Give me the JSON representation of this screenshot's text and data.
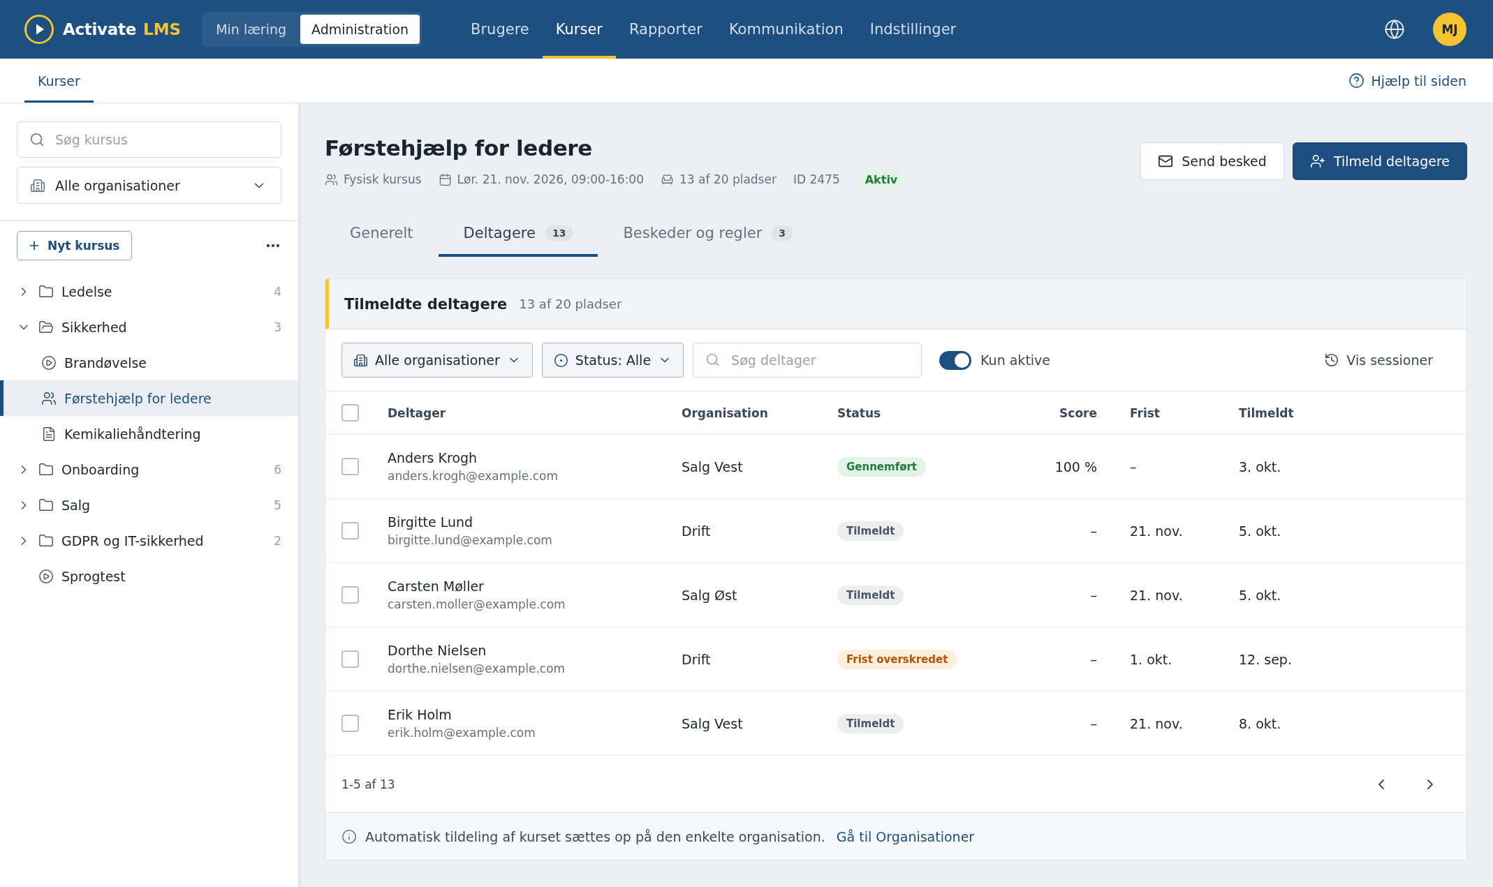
{
  "header": {
    "logo": {
      "name": "Activate",
      "suffix": "LMS"
    },
    "mode_switch": [
      {
        "label": "Min læring",
        "selected": false
      },
      {
        "label": "Administration",
        "selected": true
      }
    ],
    "nav": [
      {
        "label": "Brugere",
        "selected": false
      },
      {
        "label": "Kurser",
        "selected": true
      },
      {
        "label": "Rapporter",
        "selected": false
      },
      {
        "label": "Kommunikation",
        "selected": false
      },
      {
        "label": "Indstillinger",
        "selected": false
      }
    ],
    "avatar": {
      "initials": "MJ"
    }
  },
  "subnav": {
    "tabs": [
      {
        "label": "Kurser",
        "selected": true
      }
    ],
    "help_link": "Hjælp til siden"
  },
  "sidebar": {
    "search": {
      "placeholder": "Søg kursus"
    },
    "organisation_select": {
      "value": "Alle organisationer"
    },
    "new_button": "Nyt kursus",
    "tree": [
      {
        "kind": "folder",
        "label": "Ledelse",
        "count": "4",
        "expanded": false,
        "selected": false
      },
      {
        "kind": "folder",
        "label": "Sikkerhed",
        "count": "3",
        "expanded": true,
        "selected": false,
        "children": [
          {
            "kind": "elearning",
            "label": "Brandøvelse",
            "selected": false
          },
          {
            "kind": "classroom",
            "label": "Førstehjælp for ledere",
            "selected": true
          },
          {
            "kind": "document",
            "label": "Kemikaliehåndtering",
            "selected": false
          }
        ]
      },
      {
        "kind": "folder",
        "label": "Onboarding",
        "count": "6",
        "expanded": false,
        "selected": false
      },
      {
        "kind": "folder",
        "label": "Salg",
        "count": "5",
        "expanded": false,
        "selected": false
      },
      {
        "kind": "folder",
        "label": "GDPR og IT-sikkerhed",
        "count": "2",
        "expanded": false,
        "selected": false
      },
      {
        "kind": "elearning",
        "label": "Sprogtest",
        "selected": false
      }
    ]
  },
  "course": {
    "title": "Førstehjælp for ledere",
    "meta": [
      {
        "kind": "format",
        "text": "Fysisk kursus"
      },
      {
        "kind": "date",
        "text": "Lør. 21. nov. 2026, 09:00-16:00"
      },
      {
        "kind": "seats",
        "text": "13 af 20 pladser"
      },
      {
        "kind": "id",
        "text": "ID 2475"
      }
    ],
    "status": "Aktiv",
    "actions": [
      {
        "kind": "secondary",
        "label": "Send besked"
      },
      {
        "kind": "primary",
        "label": "Tilmeld deltagere"
      }
    ],
    "tabs": [
      {
        "label": "Generelt",
        "selected": false
      },
      {
        "label": "Deltagere",
        "count": "13",
        "selected": true
      },
      {
        "label": "Beskeder og regler",
        "count": "3",
        "selected": false
      }
    ]
  },
  "participants": {
    "title": "Tilmeldte deltagere",
    "subtitle": "13 af 20 pladser",
    "filters": {
      "organisation": "Alle organisationer",
      "status": "Status: Alle",
      "search": {
        "placeholder": "Søg deltager"
      },
      "active_only": {
        "label": "Kun aktive",
        "on": true
      },
      "sessions_button": "Vis sessioner"
    },
    "table": {
      "select_all": {
        "checked": false
      },
      "columns": [
        "Deltager",
        "Organisation",
        "Status",
        "Score",
        "Frist",
        "Tilmeldt"
      ],
      "rows": [
        {
          "checked": false,
          "name": "Anders Krogh",
          "email": "anders.krogh@example.com",
          "organisation": "Salg Vest",
          "status": {
            "kind": "completed",
            "label": "Gennemført"
          },
          "score": "100 %",
          "deadline": "–",
          "enrolled": "3. okt."
        },
        {
          "checked": false,
          "name": "Birgitte Lund",
          "email": "birgitte.lund@example.com",
          "organisation": "Drift",
          "status": {
            "kind": "enrolled",
            "label": "Tilmeldt"
          },
          "score": "–",
          "deadline": "21. nov.",
          "enrolled": "5. okt."
        },
        {
          "checked": false,
          "name": "Carsten Møller",
          "email": "carsten.moller@example.com",
          "organisation": "Salg Øst",
          "status": {
            "kind": "enrolled",
            "label": "Tilmeldt"
          },
          "score": "–",
          "deadline": "21. nov.",
          "enrolled": "5. okt."
        },
        {
          "checked": false,
          "name": "Dorthe Nielsen",
          "email": "dorthe.nielsen@example.com",
          "organisation": "Drift",
          "status": {
            "kind": "overdue",
            "label": "Frist overskredet"
          },
          "score": "–",
          "deadline": "1. okt.",
          "enrolled": "12. sep."
        },
        {
          "checked": false,
          "name": "Erik Holm",
          "email": "erik.holm@example.com",
          "organisation": "Salg Vest",
          "status": {
            "kind": "enrolled",
            "label": "Tilmeldt"
          },
          "score": "–",
          "deadline": "21. nov.",
          "enrolled": "8. okt."
        }
      ]
    },
    "pagination": {
      "range": "1-5 af 13"
    },
    "footer": {
      "text": "Automatisk tildeling af kurset sættes op på den enkelte organisation.",
      "link": "Gå til Organisationer"
    }
  }
}
